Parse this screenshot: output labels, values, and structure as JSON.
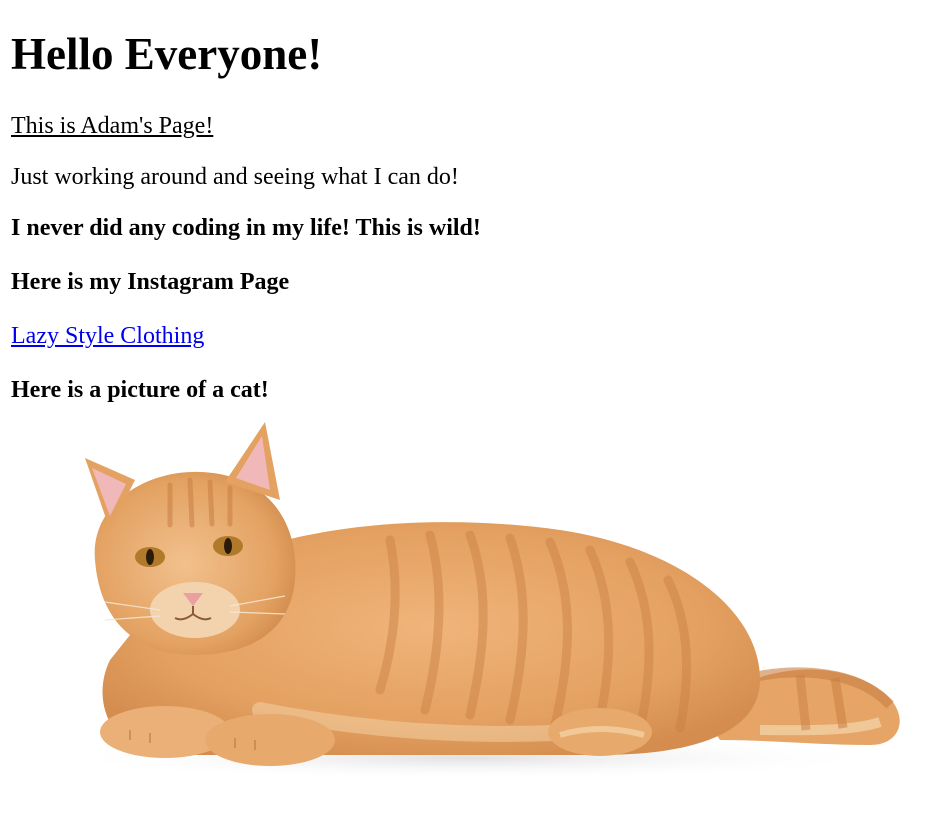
{
  "page": {
    "heading": "Hello Everyone!",
    "intro_underlined": "This is Adam's Page!",
    "intro_line": "Just working around and seeing what I can do!",
    "bold_line_1": "I never did any coding in my life! This is wild!",
    "bold_line_2": "Here is my Instagram Page",
    "instagram_link": "Lazy Style Clothing",
    "bold_line_3": "Here is a picture of a cat!"
  },
  "image": {
    "subject": "orange-tabby-cat-lying",
    "colors": {
      "fur_base": "#e6a567",
      "fur_light": "#f3cfa4",
      "stripes": "#c97f42",
      "nose": "#e8a0a0",
      "ear_inner": "#f0b8b8",
      "eyes": "#b07a2a"
    }
  }
}
